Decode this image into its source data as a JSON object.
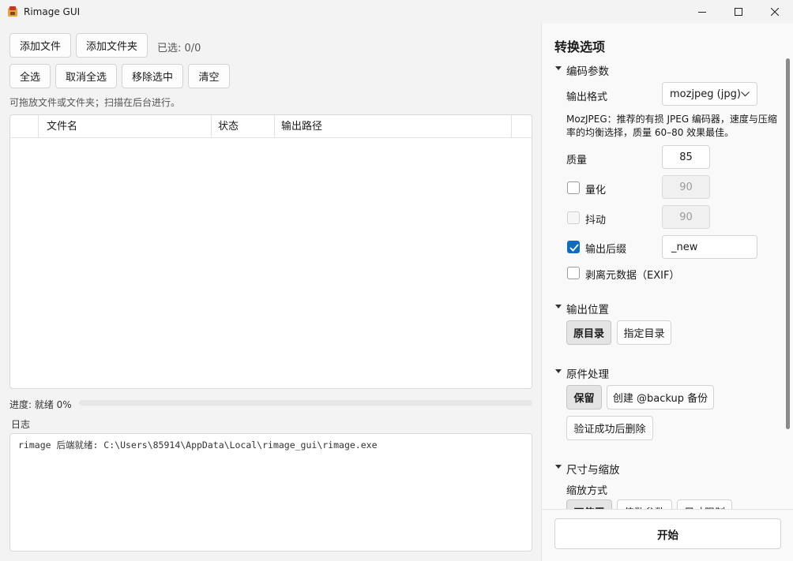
{
  "window": {
    "title": "Rimage GUI"
  },
  "toolbar": {
    "add_files": "添加文件",
    "add_folder": "添加文件夹",
    "selected": "已选: 0/0",
    "select_all": "全选",
    "deselect_all": "取消全选",
    "remove_selected": "移除选中",
    "clear": "清空",
    "hint": "可拖放文件或文件夹；扫描在后台进行。"
  },
  "table": {
    "columns": [
      "",
      "文件名",
      "状态",
      "输出路径"
    ],
    "rows": []
  },
  "progress": {
    "label": "进度: 就绪 0%",
    "value": 0
  },
  "log": {
    "title": "日志",
    "lines": [
      "rimage 后端就绪: C:\\Users\\85914\\AppData\\Local\\rimage_gui\\rimage.exe"
    ]
  },
  "options": {
    "title": "转换选项",
    "encoding": {
      "title": "编码参数",
      "format_label": "输出格式",
      "format_value": "mozjpeg (jpg)",
      "description": "MozJPEG：推荐的有损 JPEG 编码器，速度与压缩率的均衡选择，质量 60–80 效果最佳。",
      "quality_label": "质量",
      "quality_value": "85",
      "quantize_label": "量化",
      "quantize_value": "90",
      "quantize_checked": false,
      "dither_label": "抖动",
      "dither_value": "90",
      "dither_checked": false,
      "suffix_label": "输出后缀",
      "suffix_value": "_new",
      "suffix_checked": true,
      "strip_label": "剥离元数据（EXIF）",
      "strip_checked": false
    },
    "output_location": {
      "title": "输出位置",
      "original_dir": "原目录",
      "custom_dir": "指定目录",
      "selected": "原目录"
    },
    "original_handling": {
      "title": "原件处理",
      "keep": "保留",
      "backup": "创建 @backup 备份",
      "delete_after": "验证成功后删除",
      "selected": "保留"
    },
    "resize": {
      "title": "尺寸与缩放",
      "mode_label": "缩放方式",
      "modes": [
        "不使用",
        "倍数参数",
        "尺寸限制"
      ],
      "selected": "不使用"
    },
    "start": "开始"
  },
  "colors": {
    "accent": "#0f6cbd",
    "progress": "#3a78c3"
  }
}
